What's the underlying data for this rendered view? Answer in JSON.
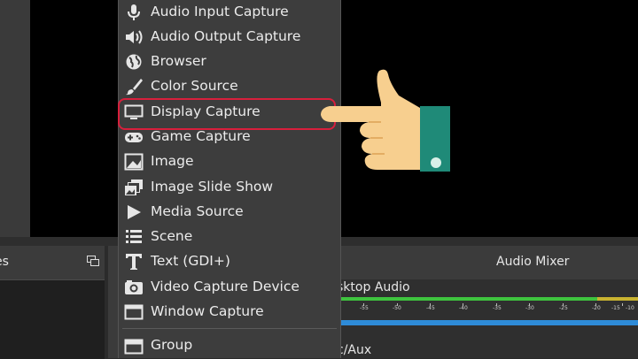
{
  "sources_menu": {
    "items": [
      {
        "label": "Audio Input Capture",
        "icon": "microphone-icon"
      },
      {
        "label": "Audio Output Capture",
        "icon": "speaker-icon"
      },
      {
        "label": "Browser",
        "icon": "globe-icon"
      },
      {
        "label": "Color Source",
        "icon": "paintbrush-icon"
      },
      {
        "label": "Display Capture",
        "icon": "monitor-icon"
      },
      {
        "label": "Game Capture",
        "icon": "gamepad-icon"
      },
      {
        "label": "Image",
        "icon": "image-icon"
      },
      {
        "label": "Image Slide Show",
        "icon": "slideshow-icon"
      },
      {
        "label": "Media Source",
        "icon": "play-icon"
      },
      {
        "label": "Scene",
        "icon": "list-icon"
      },
      {
        "label": "Text (GDI+)",
        "icon": "text-icon"
      },
      {
        "label": "Video Capture Device",
        "icon": "camera-icon"
      },
      {
        "label": "Window Capture",
        "icon": "window-icon"
      },
      {
        "label": "Group",
        "icon": "folder-icon"
      }
    ],
    "highlighted_item": "Display Capture"
  },
  "scenes_dock": {
    "title": "es"
  },
  "audio_mixer": {
    "title": "Audio Mixer",
    "channels": [
      {
        "label": "sktop Audio"
      },
      {
        "label": "c/Aux"
      }
    ],
    "scale_labels": [
      "-55",
      "-50",
      "-45",
      "-40",
      "-35",
      "-30",
      "-25",
      "-20",
      "-15",
      "-10"
    ]
  },
  "colors": {
    "highlight": "#d81f3c",
    "meter_green": "#3ec43e",
    "fader_blue": "#2e8bd8",
    "cuff": "#1f8a78",
    "skin": "#f7cf8f"
  }
}
